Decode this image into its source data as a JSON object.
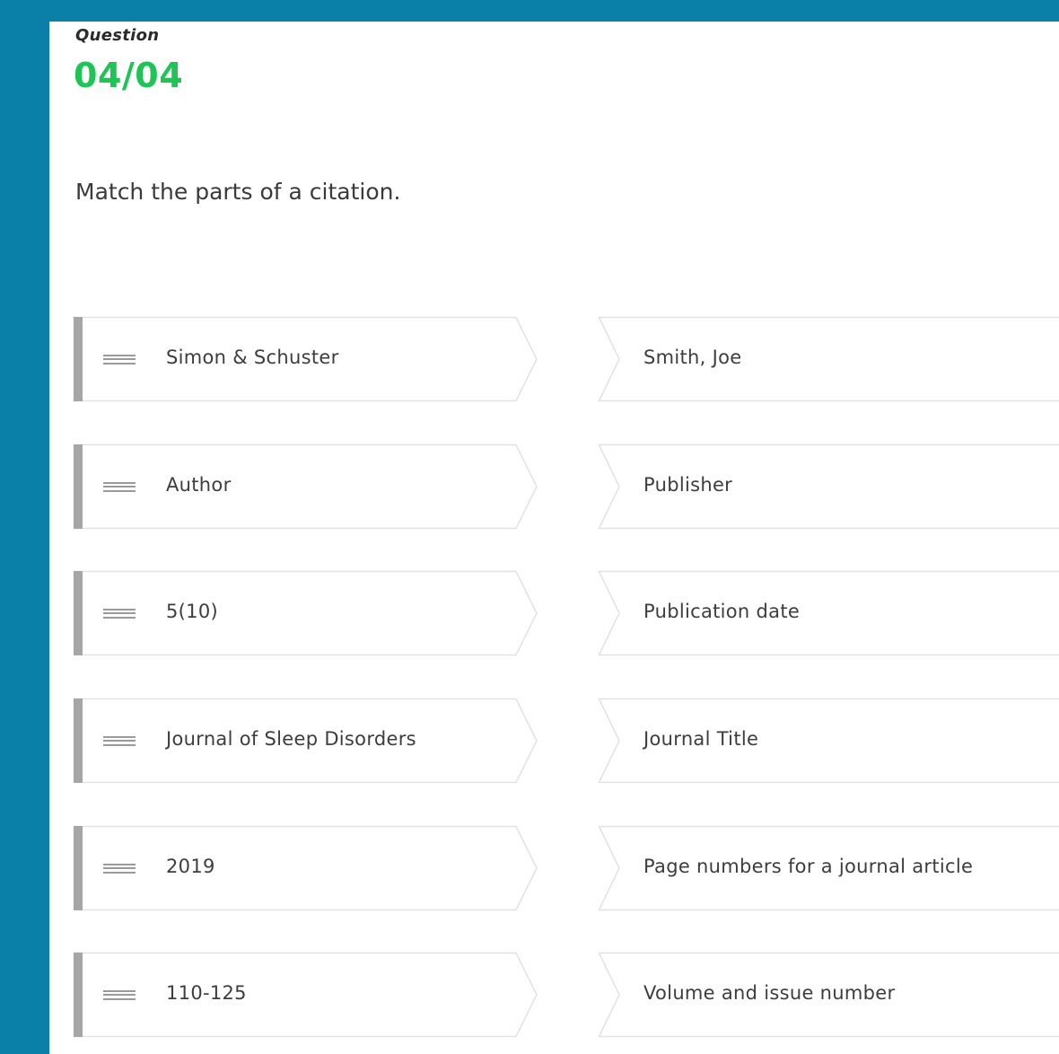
{
  "question": {
    "label": "Question",
    "number": "04/04",
    "prompt": "Match the parts of a citation."
  },
  "draggable_items": [
    {
      "label": "Simon & Schuster"
    },
    {
      "label": "Author"
    },
    {
      "label": "5(10)"
    },
    {
      "label": "Journal of Sleep Disorders"
    },
    {
      "label": "2019"
    },
    {
      "label": "110-125"
    }
  ],
  "targets": [
    {
      "label": "Smith, Joe"
    },
    {
      "label": "Publisher"
    },
    {
      "label": "Publication date"
    },
    {
      "label": "Journal Title"
    },
    {
      "label": "Page numbers for a journal article"
    },
    {
      "label": "Volume and issue number"
    }
  ],
  "colors": {
    "background": "#0a7fa8",
    "accent_green": "#1fc457",
    "left_bar": "#a6a6a6",
    "border": "#e2e2e2"
  },
  "icons": {
    "drag_handle": "drag-handle-icon"
  }
}
